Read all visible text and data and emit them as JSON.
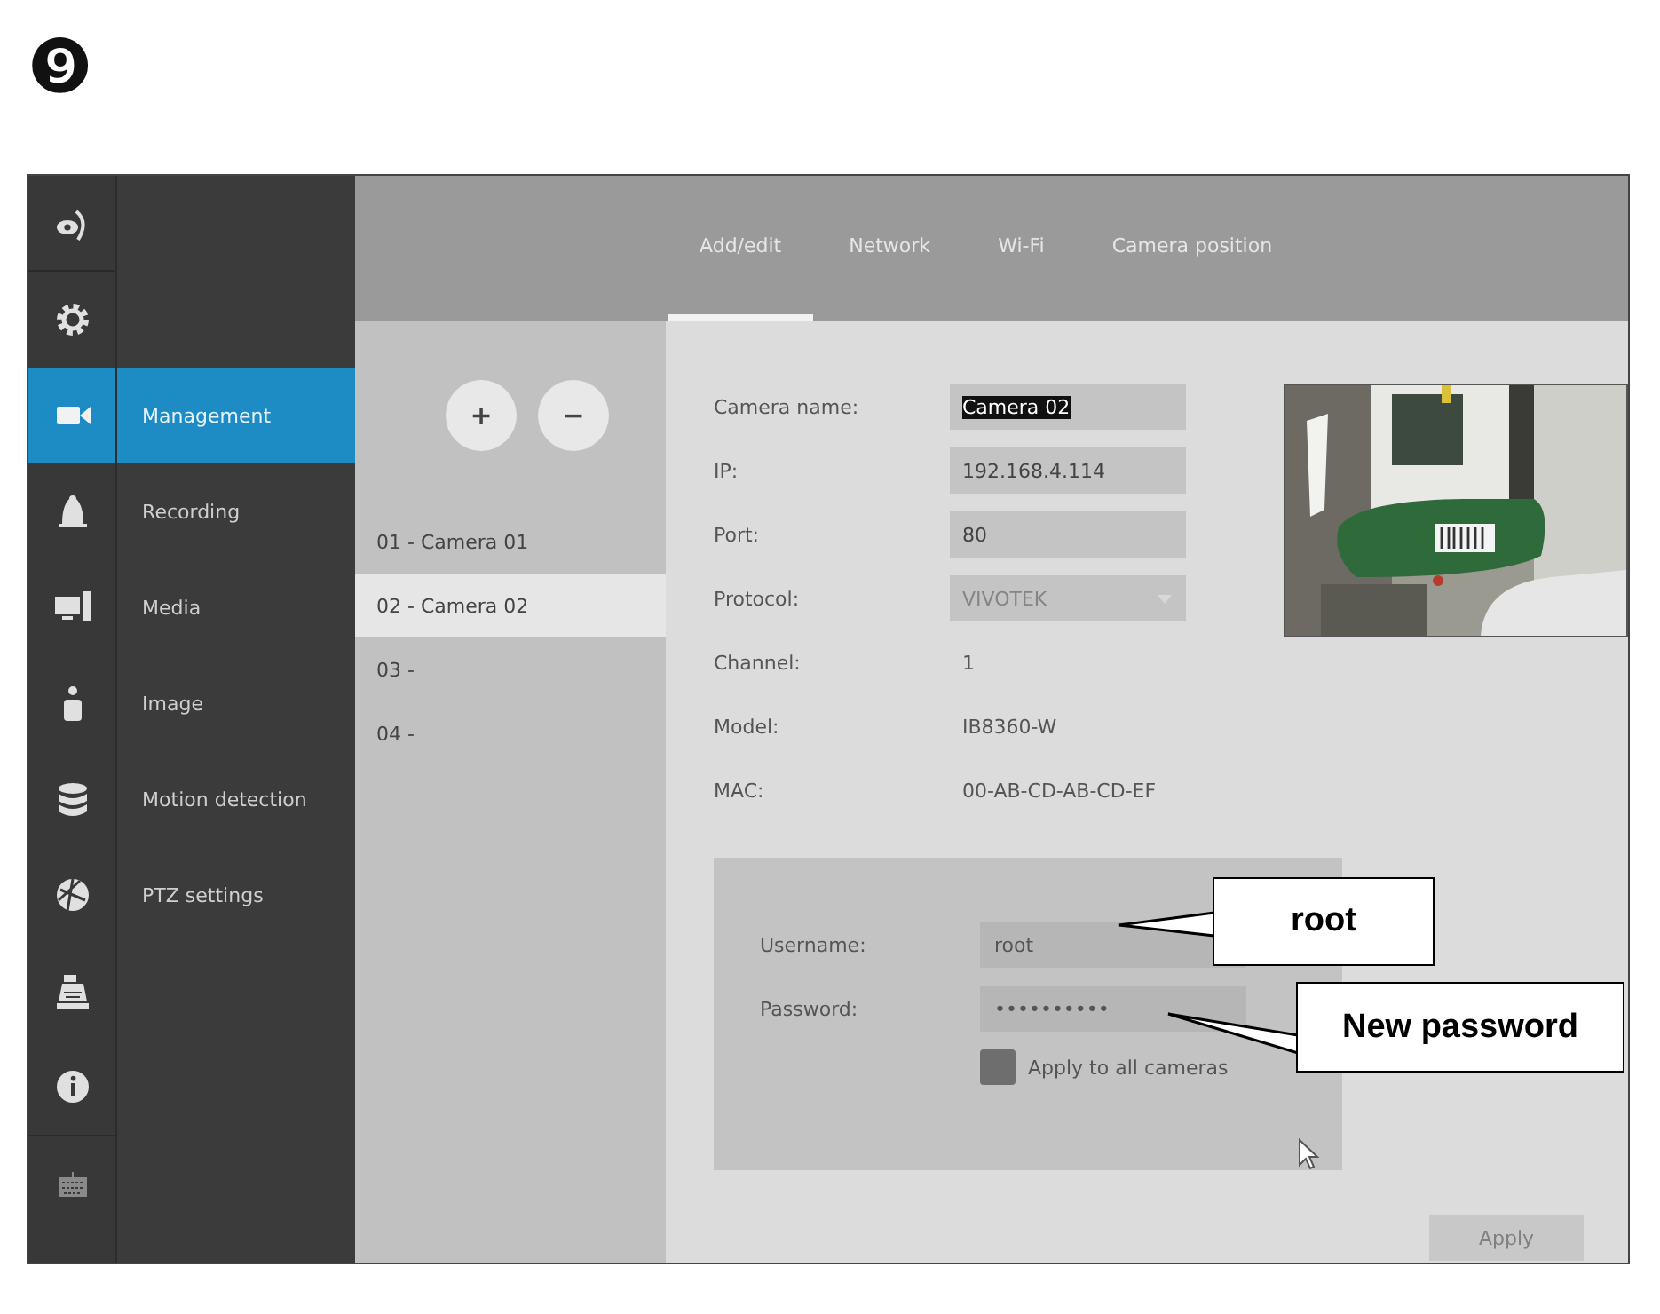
{
  "step": "❾",
  "rail": [
    {
      "selected": false
    },
    {
      "selected": false
    },
    {
      "selected": true
    },
    {
      "selected": false
    },
    {
      "selected": false
    },
    {
      "selected": false
    },
    {
      "selected": false
    },
    {
      "selected": false
    },
    {
      "selected": false
    },
    {
      "selected": false
    },
    {
      "selected": false
    }
  ],
  "menu": [
    {
      "label": "Management",
      "selected": true
    },
    {
      "label": "Recording",
      "selected": false
    },
    {
      "label": "Media",
      "selected": false
    },
    {
      "label": "Image",
      "selected": false
    },
    {
      "label": "Motion detection",
      "selected": false
    },
    {
      "label": "PTZ settings",
      "selected": false
    }
  ],
  "tabs": [
    {
      "label": "Add/edit",
      "selected": true
    },
    {
      "label": "Network",
      "selected": false
    },
    {
      "label": "Wi-Fi",
      "selected": false
    },
    {
      "label": "Camera position",
      "selected": false
    }
  ],
  "camera_list": {
    "add": "+",
    "remove": "−",
    "items": [
      {
        "label": "01 - Camera 01",
        "selected": false
      },
      {
        "label": "02 - Camera 02",
        "selected": true
      },
      {
        "label": "03 -",
        "selected": false
      },
      {
        "label": "04 -",
        "selected": false
      }
    ]
  },
  "form": [
    {
      "kind": "input",
      "label": "Camera name:",
      "value": "Camera 02",
      "highlighted": true
    },
    {
      "kind": "input",
      "label": "IP:",
      "value": "192.168.4.114",
      "highlighted": false
    },
    {
      "kind": "input",
      "label": "Port:",
      "value": "80",
      "highlighted": false
    },
    {
      "kind": "dropdown",
      "label": "Protocol:",
      "value": "VIVOTEK",
      "disabled": true
    },
    {
      "kind": "text",
      "label": "Channel:",
      "value": "1"
    },
    {
      "kind": "text",
      "label": "Model:",
      "value": "IB8360-W"
    },
    {
      "kind": "text",
      "label": "MAC:",
      "value": "00-AB-CD-AB-CD-EF"
    }
  ],
  "credentials": {
    "username_label": "Username:",
    "username": "root",
    "password_label": "Password:",
    "password": "••••••••••",
    "apply_all": {
      "label": "Apply to all cameras",
      "checked": false
    }
  },
  "apply_button": {
    "label": "Apply",
    "disabled": true
  },
  "callouts": [
    {
      "text": "root"
    },
    {
      "text": "New password"
    }
  ]
}
